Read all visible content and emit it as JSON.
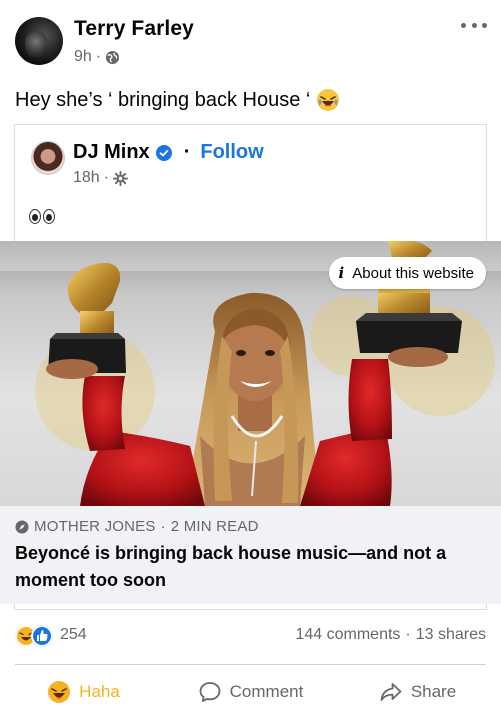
{
  "post": {
    "author": "Terry Farley",
    "time": "9h",
    "meta_sep": "·",
    "text": "Hey she’s ‘ bringing back House ‘"
  },
  "shared": {
    "author": "DJ Minx",
    "follow_sep": "·",
    "follow_label": "Follow",
    "time": "18h",
    "meta_sep": "·"
  },
  "link": {
    "about_label": "About this website",
    "source": "MOTHER JONES",
    "read_sep": "·",
    "read_time": "2 MIN READ",
    "headline": "Beyoncé is bringing back house music—and not a moment too soon"
  },
  "stats": {
    "reaction_count": "254",
    "comments": "144 comments",
    "stats_sep": "·",
    "shares": "13 shares"
  },
  "actions": {
    "haha": "Haha",
    "comment": "Comment",
    "share": "Share"
  },
  "colors": {
    "accent": "#1b74e4",
    "haha": "#f7b125",
    "meta": "#65676b",
    "dress": "#c4161c"
  },
  "icons": [
    "globe-icon",
    "more-icon",
    "laugh-emoji-icon",
    "verified-icon",
    "gear-icon",
    "eyes-emoji-icon",
    "info-icon",
    "compass-icon",
    "haha-reaction-icon",
    "like-reaction-icon",
    "comment-icon",
    "share-icon"
  ]
}
